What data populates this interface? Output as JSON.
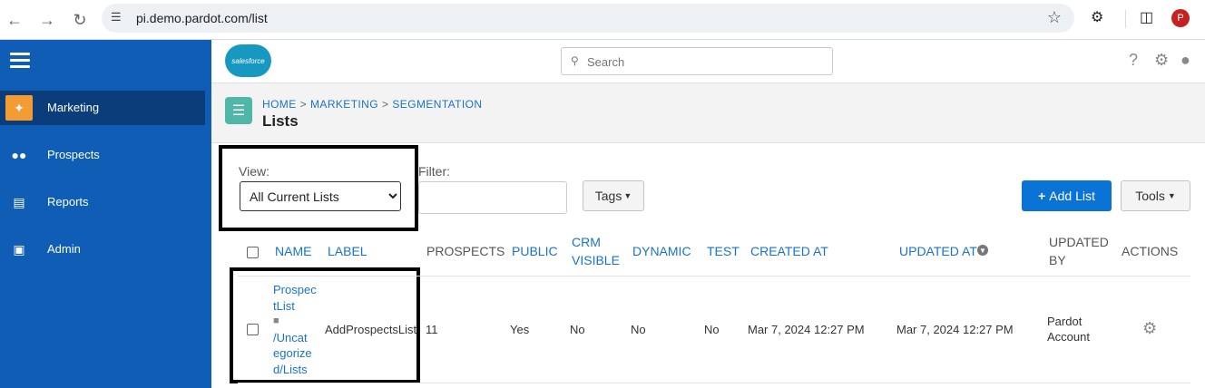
{
  "browser": {
    "url": "pi.demo.pardot.com/list",
    "profile_initial": "P"
  },
  "sidebar": {
    "items": [
      {
        "label": "Marketing",
        "icon": "magic-wand-icon",
        "active": true
      },
      {
        "label": "Prospects",
        "icon": "people-icon",
        "active": false
      },
      {
        "label": "Reports",
        "icon": "bar-chart-icon",
        "active": false
      },
      {
        "label": "Admin",
        "icon": "briefcase-icon",
        "active": false
      }
    ]
  },
  "header": {
    "logo_text": "salesforce",
    "search_placeholder": "Search"
  },
  "breadcrumb": {
    "items": [
      "HOME",
      "MARKETING",
      "SEGMENTATION"
    ],
    "separator": ">",
    "title": "Lists"
  },
  "filters": {
    "view_label": "View:",
    "view_selected": "All Current Lists",
    "filter_label": "Filter:",
    "tags_label": "Tags",
    "add_list_label": "Add List",
    "tools_label": "Tools"
  },
  "table": {
    "columns": [
      "NAME",
      "LABEL",
      "PROSPECTS",
      "PUBLIC",
      "CRM",
      "VISIBLE",
      "DYNAMIC",
      "TEST",
      "CREATED AT",
      "UPDATED AT",
      "UPDATED",
      "BY",
      "ACTIONS"
    ],
    "rows": [
      {
        "name_lines": [
          "Prospec",
          "tList",
          "/Uncat",
          "egorize",
          "d/Lists"
        ],
        "label": "AddProspectsList",
        "prospects": "11",
        "public": "Yes",
        "crm_visible": "No",
        "dynamic": "No",
        "test": "No",
        "created_at": "Mar 7, 2024 12:27 PM",
        "updated_at": "Mar 7, 2024 12:27 PM",
        "updated_by_lines": [
          "Pardot",
          "Account"
        ]
      }
    ]
  },
  "colors": {
    "sidebar_bg": "#0f5db5",
    "sidebar_active": "#0a3d79",
    "accent": "#0c73d6",
    "link": "#1a73c8"
  }
}
